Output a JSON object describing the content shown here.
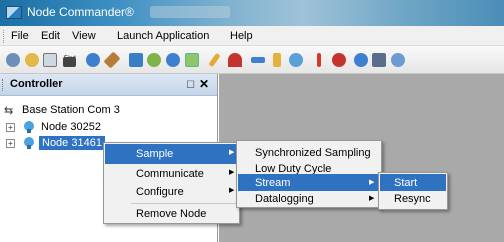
{
  "window": {
    "title": "Node Commander®"
  },
  "menubar": {
    "items": [
      "File",
      "Edit",
      "View",
      "Launch Application",
      "Help"
    ]
  },
  "toolbar": {
    "icons": [
      "wizard-icon",
      "connect-icon",
      "device-icon",
      "find-icon",
      "radio-icon",
      "tools-icon",
      "flag-icon",
      "check-icon",
      "download-icon",
      "save-icon",
      "pencil-icon",
      "signal-icon",
      "wave-icon",
      "marker-icon",
      "sync-icon",
      "chart-icon",
      "stop-icon",
      "forward-icon",
      "disk-icon",
      "help-icon"
    ],
    "find_label": "Find"
  },
  "panel": {
    "title": "Controller",
    "pin_glyph": "◻",
    "close_glyph": "✕"
  },
  "tree": {
    "root": "Base Station Com 3",
    "nodes": [
      {
        "label": "Node 30252",
        "selected": false
      },
      {
        "label": "Node 31461",
        "selected": true
      }
    ]
  },
  "context_menu": {
    "items": [
      "Sample",
      "Communicate",
      "Configure",
      "Remove Node"
    ],
    "highlighted": "Sample"
  },
  "sample_submenu": {
    "items": [
      "Synchronized Sampling",
      "Low Duty Cycle",
      "Stream",
      "Datalogging"
    ],
    "highlighted": "Stream"
  },
  "stream_submenu": {
    "items": [
      "Start",
      "Resync"
    ],
    "highlighted": "Start"
  },
  "colors": {
    "selection": "#2f72c2",
    "workspace": "#a9a9a9"
  }
}
